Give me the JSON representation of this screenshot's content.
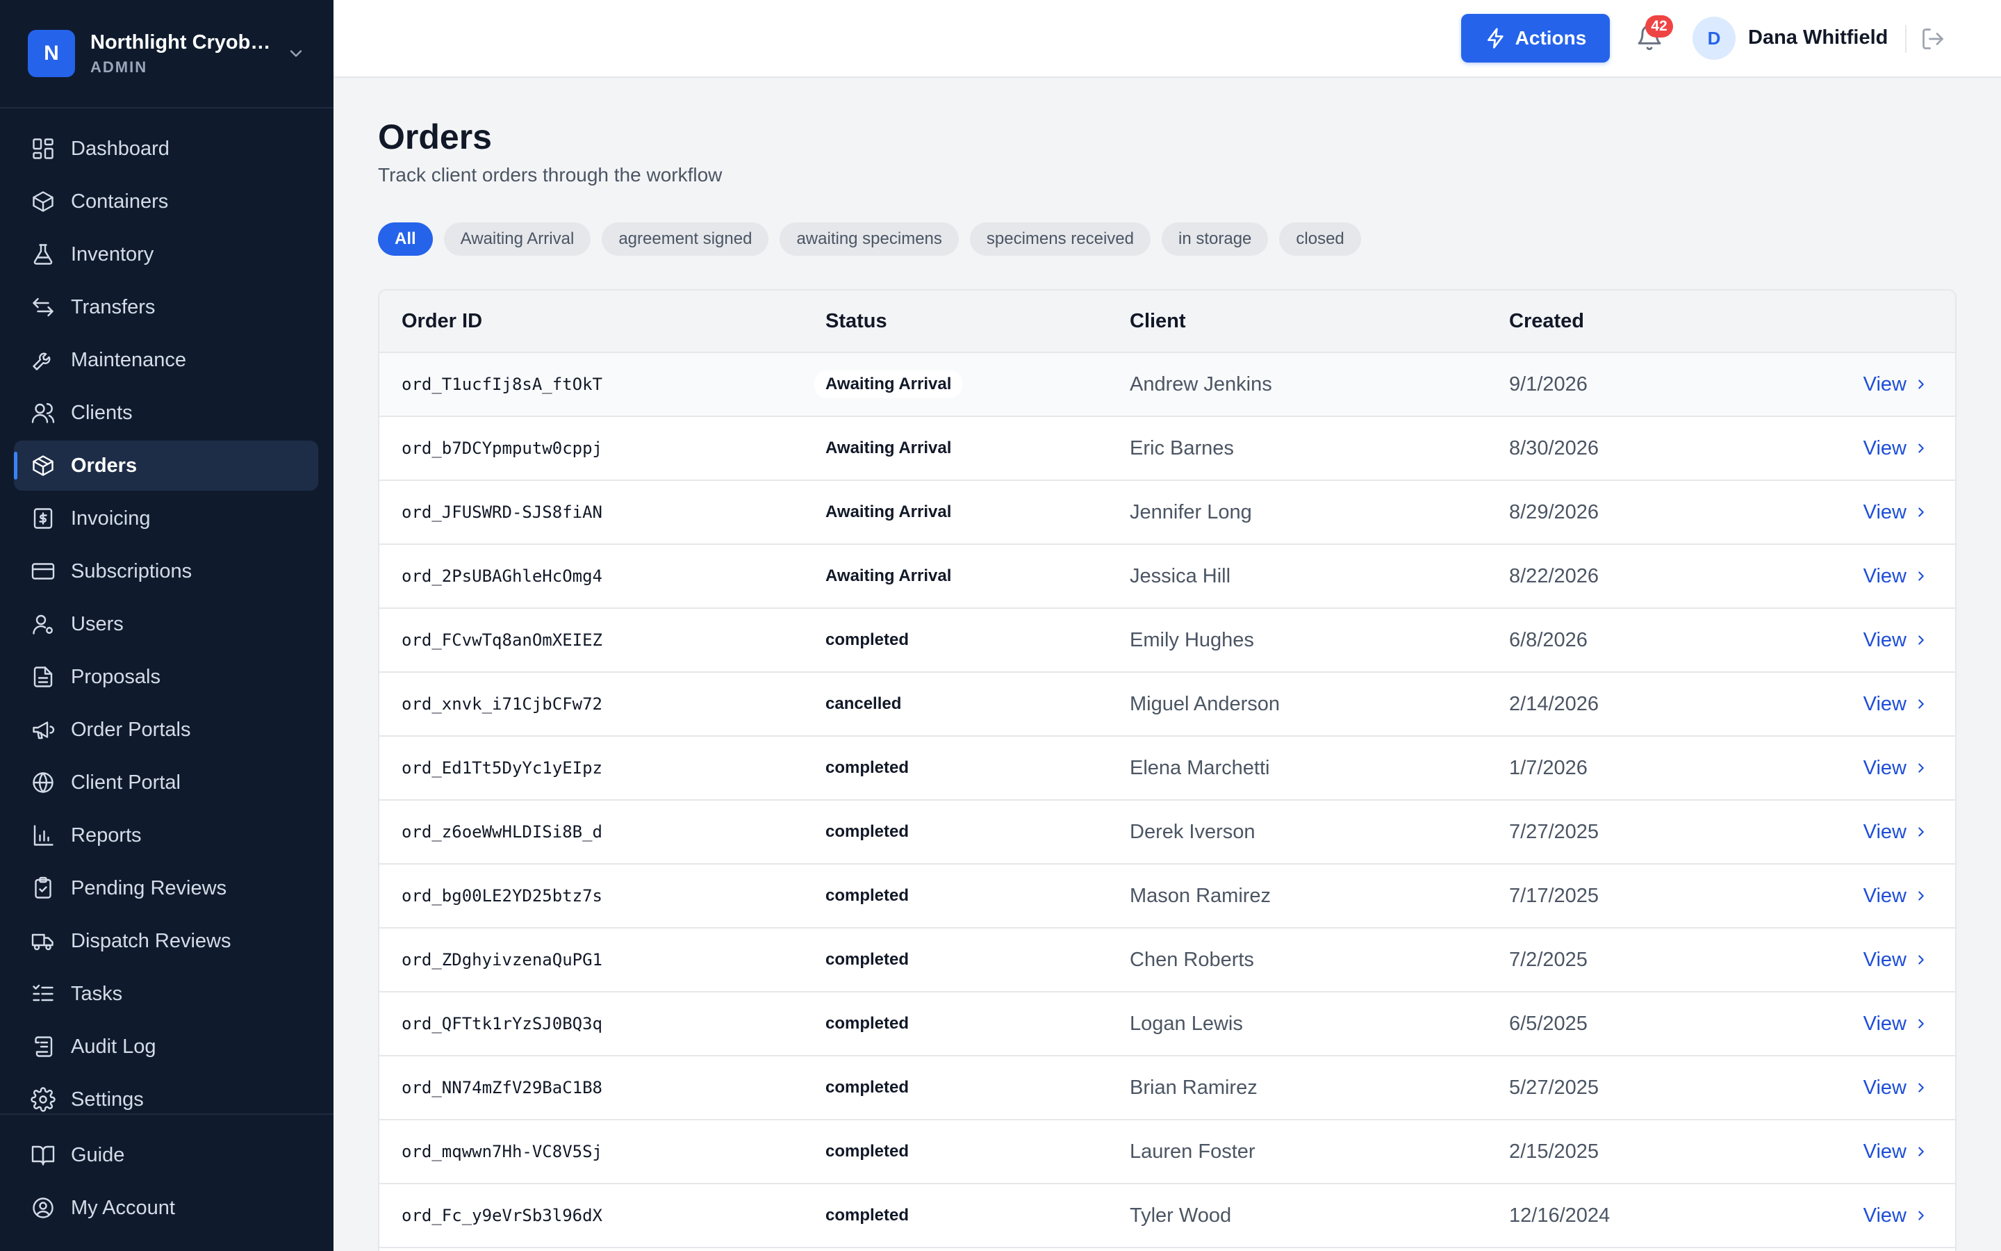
{
  "org": {
    "initial": "N",
    "name": "Northlight Cryoba…",
    "role": "ADMIN"
  },
  "nav": [
    {
      "label": "Dashboard",
      "icon": "dashboard-icon"
    },
    {
      "label": "Containers",
      "icon": "box-icon"
    },
    {
      "label": "Inventory",
      "icon": "flask-icon"
    },
    {
      "label": "Transfers",
      "icon": "transfer-icon"
    },
    {
      "label": "Maintenance",
      "icon": "wrench-icon"
    },
    {
      "label": "Clients",
      "icon": "users-icon"
    },
    {
      "label": "Orders",
      "icon": "package-icon",
      "active": true
    },
    {
      "label": "Invoicing",
      "icon": "invoice-icon"
    },
    {
      "label": "Subscriptions",
      "icon": "card-icon"
    },
    {
      "label": "Users",
      "icon": "user-gear-icon"
    },
    {
      "label": "Proposals",
      "icon": "document-icon"
    },
    {
      "label": "Order Portals",
      "icon": "megaphone-icon"
    },
    {
      "label": "Client Portal",
      "icon": "globe-icon"
    },
    {
      "label": "Reports",
      "icon": "bar-chart-icon"
    },
    {
      "label": "Pending Reviews",
      "icon": "clipboard-check-icon"
    },
    {
      "label": "Dispatch Reviews",
      "icon": "truck-icon"
    },
    {
      "label": "Tasks",
      "icon": "tasks-icon"
    },
    {
      "label": "Audit Log",
      "icon": "scroll-icon"
    },
    {
      "label": "Settings",
      "icon": "gear-icon"
    }
  ],
  "nav_bottom": [
    {
      "label": "Guide",
      "icon": "book-icon"
    },
    {
      "label": "My Account",
      "icon": "user-circle-icon"
    }
  ],
  "topbar": {
    "actions_label": "Actions",
    "notification_count": "42",
    "user_initial": "D",
    "user_name": "Dana Whitfield"
  },
  "page": {
    "title": "Orders",
    "subtitle": "Track client orders through the workflow"
  },
  "filters": [
    "All",
    "Awaiting Arrival",
    "agreement signed",
    "awaiting specimens",
    "specimens received",
    "in storage",
    "closed"
  ],
  "table": {
    "columns": {
      "id": "Order ID",
      "status": "Status",
      "client": "Client",
      "created": "Created"
    },
    "view_label": "View",
    "rows": [
      {
        "id": "ord_T1ucfIj8sA_ftOkT",
        "status": "Awaiting Arrival",
        "client": "Andrew Jenkins",
        "created": "9/1/2026"
      },
      {
        "id": "ord_b7DCYpmputw0cppj",
        "status": "Awaiting Arrival",
        "client": "Eric Barnes",
        "created": "8/30/2026"
      },
      {
        "id": "ord_JFUSWRD-SJS8fiAN",
        "status": "Awaiting Arrival",
        "client": "Jennifer Long",
        "created": "8/29/2026"
      },
      {
        "id": "ord_2PsUBAGhleHcOmg4",
        "status": "Awaiting Arrival",
        "client": "Jessica Hill",
        "created": "8/22/2026"
      },
      {
        "id": "ord_FCvwTq8anOmXEIEZ",
        "status": "completed",
        "client": "Emily Hughes",
        "created": "6/8/2026"
      },
      {
        "id": "ord_xnvk_i71CjbCFw72",
        "status": "cancelled",
        "client": "Miguel Anderson",
        "created": "2/14/2026"
      },
      {
        "id": "ord_Ed1Tt5DyYc1yEIpz",
        "status": "completed",
        "client": "Elena Marchetti",
        "created": "1/7/2026"
      },
      {
        "id": "ord_z6oeWwHLDISi8B_d",
        "status": "completed",
        "client": "Derek Iverson",
        "created": "7/27/2025"
      },
      {
        "id": "ord_bg00LE2YD25btz7s",
        "status": "completed",
        "client": "Mason Ramirez",
        "created": "7/17/2025"
      },
      {
        "id": "ord_ZDghyivzenaQuPG1",
        "status": "completed",
        "client": "Chen Roberts",
        "created": "7/2/2025"
      },
      {
        "id": "ord_QFTtk1rYzSJ0BQ3q",
        "status": "completed",
        "client": "Logan Lewis",
        "created": "6/5/2025"
      },
      {
        "id": "ord_NN74mZfV29BaC1B8",
        "status": "completed",
        "client": "Brian Ramirez",
        "created": "5/27/2025"
      },
      {
        "id": "ord_mqwwn7Hh-VC8V5Sj",
        "status": "completed",
        "client": "Lauren Foster",
        "created": "2/15/2025"
      },
      {
        "id": "ord_Fc_y9eVrSb3l96dX",
        "status": "completed",
        "client": "Tyler Wood",
        "created": "12/16/2024"
      }
    ]
  },
  "colors": {
    "sidebar": "#0f1b2d",
    "accent": "#2563eb",
    "badge": "#ef4444",
    "link": "#1d4ed8"
  }
}
